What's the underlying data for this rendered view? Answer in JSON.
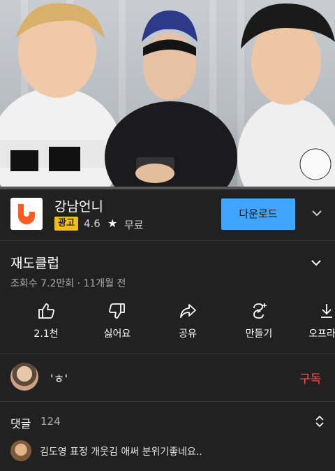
{
  "video": {
    "progress_fraction": 0.0,
    "progress_color": "#ff0000"
  },
  "ad": {
    "title": "강남언니",
    "badge": "광고",
    "rating": "4.6",
    "price": "무료",
    "download_label": "다운로드",
    "logo_color": "#ff5a1f",
    "button_color": "#3ea6ff",
    "badge_color": "#f2c00a"
  },
  "video_info": {
    "title": "재도클럽",
    "meta": "조회수 7.2만회 · 11개월 전"
  },
  "actions": [
    {
      "icon": "thumbs-up-icon",
      "label": "2.1천"
    },
    {
      "icon": "thumbs-down-icon",
      "label": "싫어요"
    },
    {
      "icon": "share-icon",
      "label": "공유"
    },
    {
      "icon": "remix-icon",
      "label": "만들기"
    },
    {
      "icon": "download-icon",
      "label": "오프라인"
    }
  ],
  "channel": {
    "name": "'ㅎ'",
    "subscribe_label": "구독",
    "subscribe_color": "#ff4e45"
  },
  "comments": {
    "header": "댓글",
    "count": "124",
    "top_comment": "김도영 표정 개웃김 애써 분위기좋네요.."
  }
}
